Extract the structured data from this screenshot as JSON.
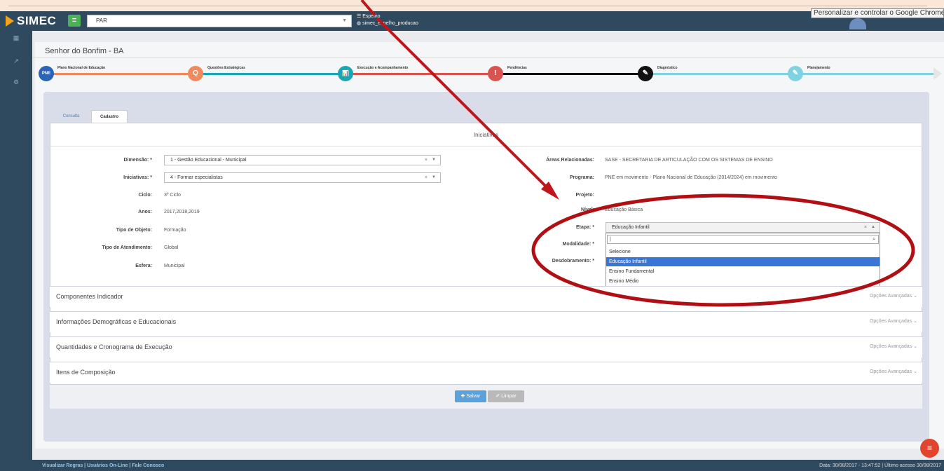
{
  "browser": {
    "tooltip": "Personalizar e controlar o Google Chrome"
  },
  "header": {
    "logo": "SIMEC",
    "program_select": "PAR",
    "env_line1": "Espelho",
    "env_line2": "simec_espelho_producao"
  },
  "page": {
    "city": "Senhor do Bonfim - BA"
  },
  "steps": [
    {
      "label": "Plano Nacional de Educação",
      "icon_text": "PNE",
      "color": "#2b64b3"
    },
    {
      "label": "Questões Estratégicas",
      "icon_text": "Q",
      "color": "#f08a5d"
    },
    {
      "label": "Execução e Acompanhamento",
      "icon_text": "📊",
      "color": "#1aa7b5"
    },
    {
      "label": "Pendências",
      "icon_text": "!",
      "color": "#d9534f"
    },
    {
      "label": "Diagnóstico",
      "icon_text": "✎",
      "color": "#111111"
    },
    {
      "label": "Planejamento",
      "icon_text": "✎",
      "color": "#7fd3e0"
    }
  ],
  "tabs": [
    {
      "label": "Consulta"
    },
    {
      "label": "Cadastro"
    }
  ],
  "form": {
    "title": "Iniciativas",
    "left": {
      "dimensao_label": "Dimensão: *",
      "dimensao_value": "1 - Gestão Educacional - Municipal",
      "iniciativas_label": "Iniciativas: *",
      "iniciativas_value": "4 - Formar especialistas",
      "ciclo_label": "Ciclo:",
      "ciclo_value": "3º Ciclo",
      "anos_label": "Anos:",
      "anos_value": "2017,2018,2019",
      "tipo_objeto_label": "Tipo de Objeto:",
      "tipo_objeto_value": "Formação",
      "tipo_atendimento_label": "Tipo de Atendimento:",
      "tipo_atendimento_value": "Global",
      "esfera_label": "Esfera:",
      "esfera_value": "Municipal"
    },
    "right": {
      "areas_label": "Áreas Relacionadas:",
      "areas_value": "SASE - SECRETARIA DE ARTICULAÇÃO COM OS SISTEMAS DE ENSINO",
      "programa_label": "Programa:",
      "programa_value": "PNE em movimento - Plano Nacional de Educação (2014/2024) em movimento",
      "projeto_label": "Projeto:",
      "nivel_label": "Nível:",
      "nivel_value": "Educação Básica",
      "etapa_label": "Etapa: *",
      "etapa_value": "Educação Infantil",
      "modalidade_label": "Modalidade: *",
      "desdobramento_label": "Desdobramento: *"
    },
    "etapa_dropdown": {
      "search_value": "|",
      "options": [
        "Selecione",
        "Educação Infantil",
        "Ensino Fundamental",
        "Ensino Médio"
      ],
      "active": "Educação Infantil"
    }
  },
  "sections": [
    {
      "title": "Componentes Indicador",
      "adv": "Opções Avançadas"
    },
    {
      "title": "Informações Demográficas e Educacionais",
      "adv": "Opções Avançadas"
    },
    {
      "title": "Quantidades e Cronograma de Execução",
      "adv": "Opções Avançadas"
    },
    {
      "title": "Itens de Composição",
      "adv": "Opções Avançadas"
    }
  ],
  "buttons": {
    "save": "Salvar",
    "clear": "Limpar"
  },
  "footer": {
    "links": "Visualizar Regras | Usuários On-Line | Fale Conosco",
    "date": "Data: 30/08/2017 - 13:47:52 | Último acesso 30/08/2017"
  },
  "annotation": {
    "arrow_color": "#c0151a",
    "ellipse_color": "#b00f14"
  }
}
